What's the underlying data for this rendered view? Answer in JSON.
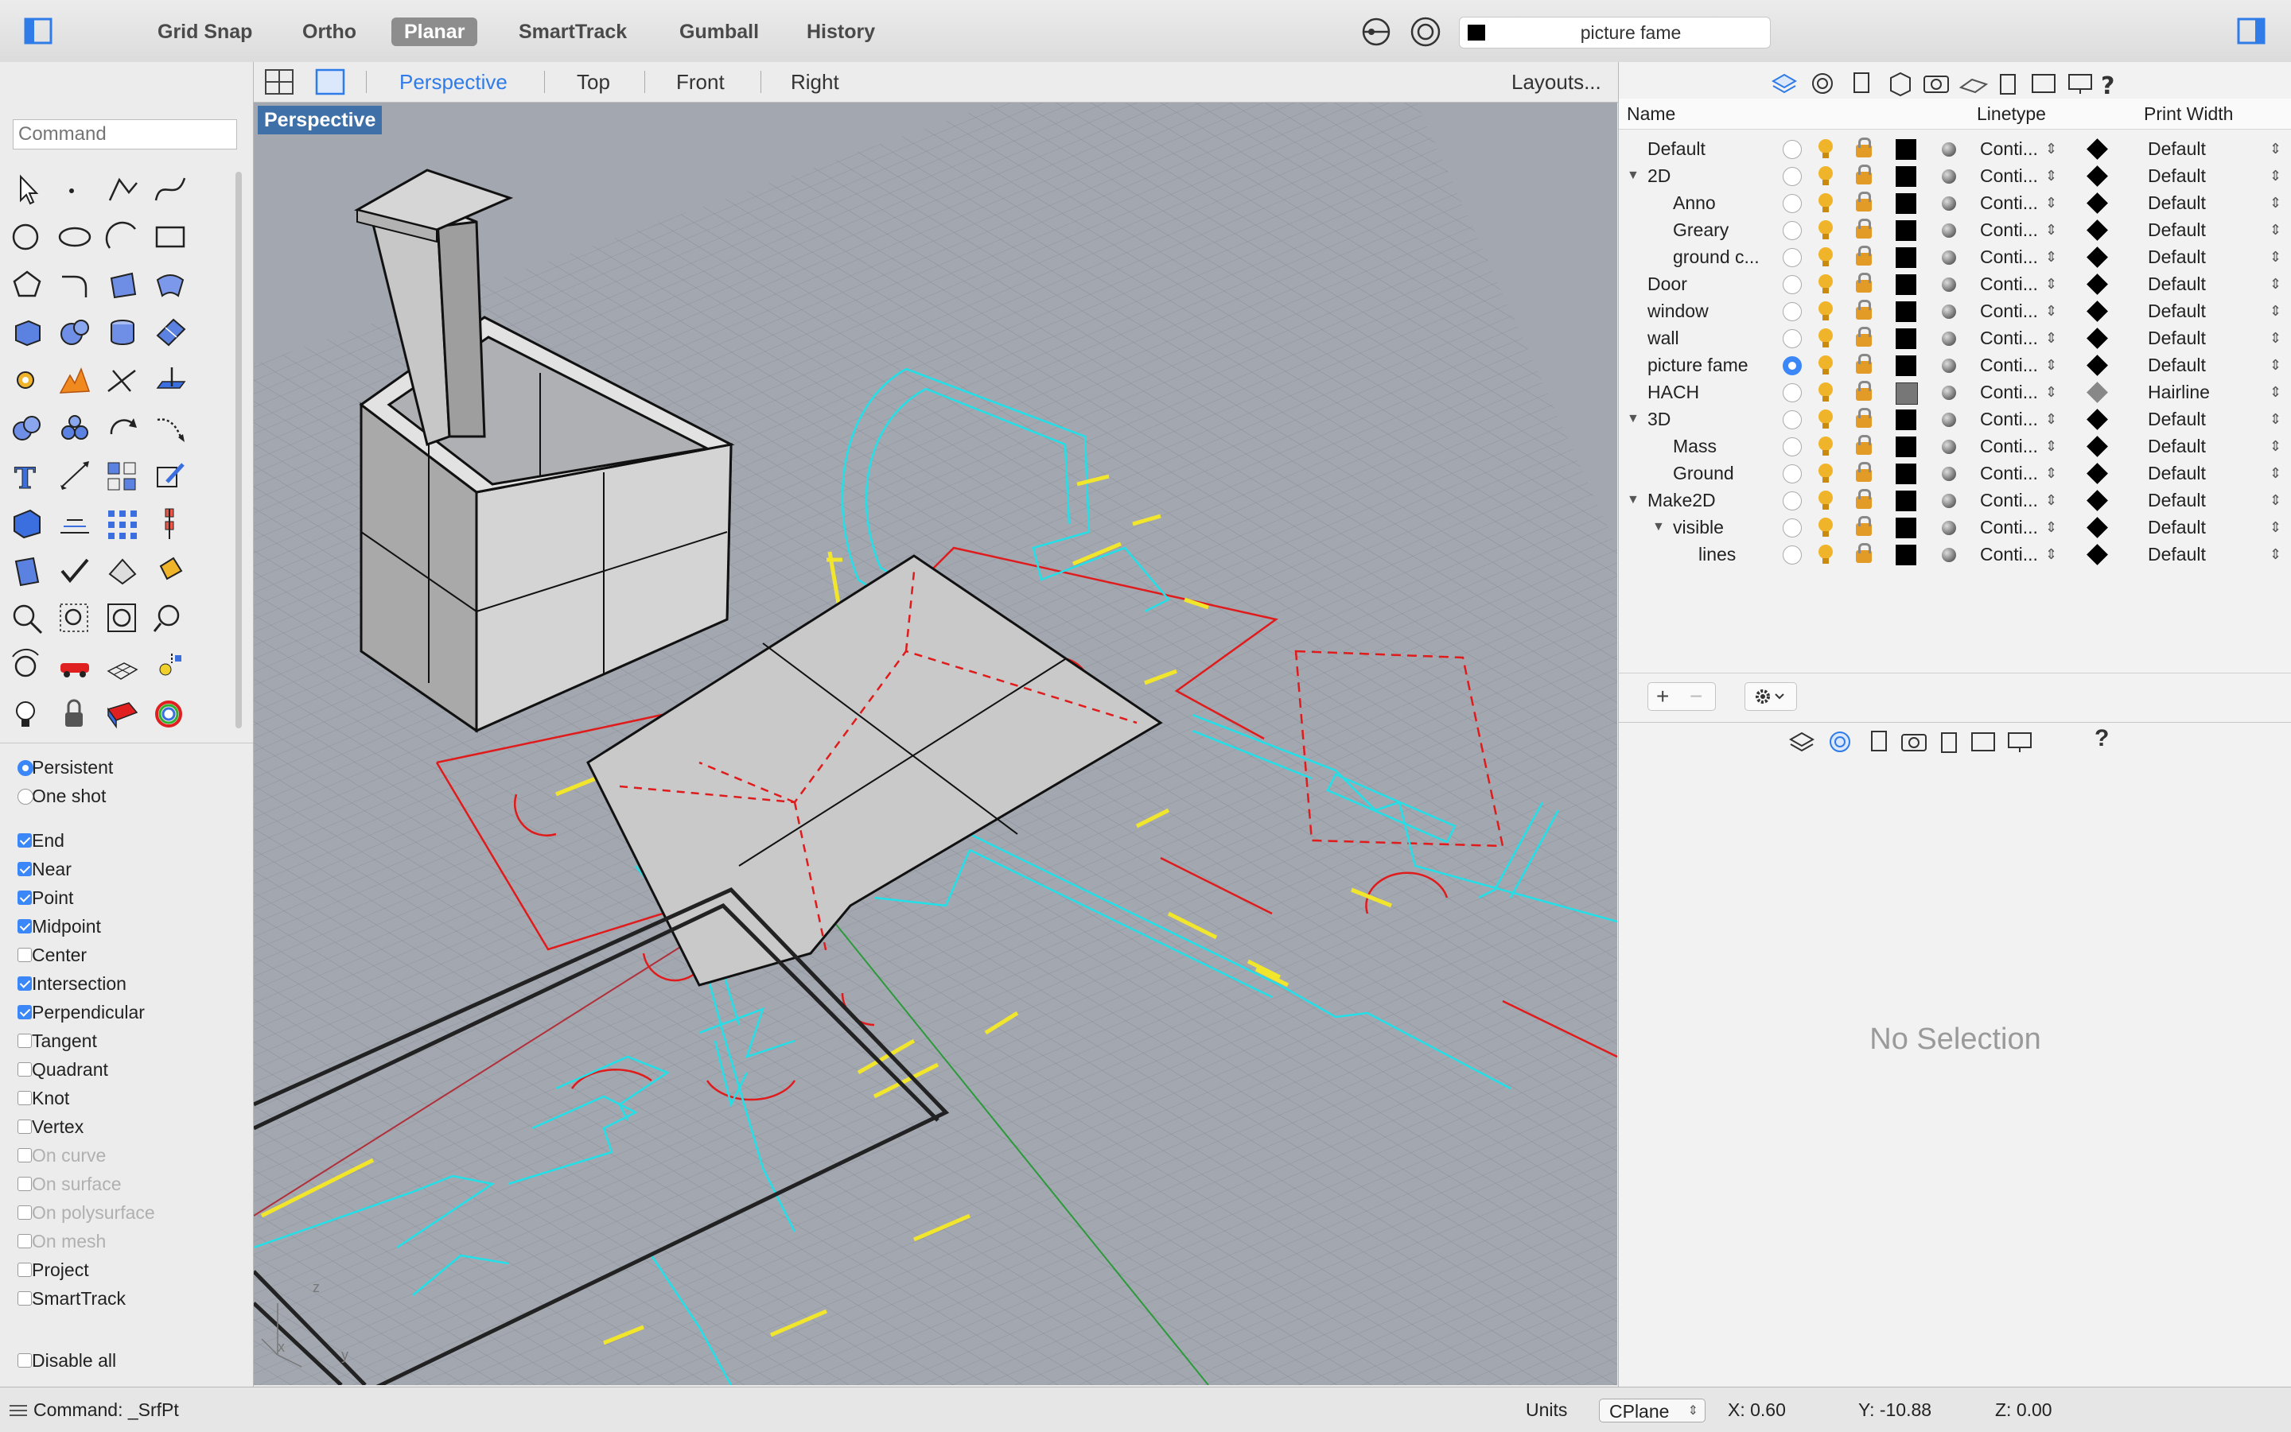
{
  "toolbar": {
    "grid_snap": "Grid Snap",
    "ortho": "Ortho",
    "planar": "Planar",
    "smarttrack": "SmartTrack",
    "gumball": "Gumball",
    "history": "History",
    "current_layer": "picture fame"
  },
  "viewbar": {
    "tabs": [
      "Perspective",
      "Top",
      "Front",
      "Right"
    ],
    "active_tab": "Perspective",
    "layouts": "Layouts..."
  },
  "command": {
    "placeholder": "Command"
  },
  "viewport": {
    "label": "Perspective",
    "axis_z": "z",
    "axis_x": "x",
    "axis_y": "y"
  },
  "snap_mode": {
    "persistent": "Persistent",
    "one_shot": "One shot",
    "selected": "Persistent"
  },
  "osnaps": [
    {
      "label": "End",
      "checked": true,
      "enabled": true
    },
    {
      "label": "Near",
      "checked": true,
      "enabled": true
    },
    {
      "label": "Point",
      "checked": true,
      "enabled": true
    },
    {
      "label": "Midpoint",
      "checked": true,
      "enabled": true
    },
    {
      "label": "Center",
      "checked": false,
      "enabled": true
    },
    {
      "label": "Intersection",
      "checked": true,
      "enabled": true
    },
    {
      "label": "Perpendicular",
      "checked": true,
      "enabled": true
    },
    {
      "label": "Tangent",
      "checked": false,
      "enabled": true
    },
    {
      "label": "Quadrant",
      "checked": false,
      "enabled": true
    },
    {
      "label": "Knot",
      "checked": false,
      "enabled": true
    },
    {
      "label": "Vertex",
      "checked": false,
      "enabled": true
    },
    {
      "label": "On curve",
      "checked": false,
      "enabled": false
    },
    {
      "label": "On surface",
      "checked": false,
      "enabled": false
    },
    {
      "label": "On polysurface",
      "checked": false,
      "enabled": false
    },
    {
      "label": "On mesh",
      "checked": false,
      "enabled": false
    },
    {
      "label": "Project",
      "checked": false,
      "enabled": true
    },
    {
      "label": "SmartTrack",
      "checked": false,
      "enabled": true
    },
    {
      "label": "Disable all",
      "checked": false,
      "enabled": true
    }
  ],
  "layers": {
    "columns": {
      "name": "Name",
      "linetype": "Linetype",
      "print_width": "Print Width"
    },
    "rows": [
      {
        "name": "Default",
        "level": 0,
        "expander": "",
        "current": false,
        "linetype": "Conti...",
        "print_width": "Default"
      },
      {
        "name": "2D",
        "level": 0,
        "expander": "▼",
        "current": false,
        "linetype": "Conti...",
        "print_width": "Default"
      },
      {
        "name": "Anno",
        "level": 1,
        "expander": "",
        "current": false,
        "linetype": "Conti...",
        "print_width": "Default"
      },
      {
        "name": "Greary",
        "level": 1,
        "expander": "",
        "current": false,
        "linetype": "Conti...",
        "print_width": "Default"
      },
      {
        "name": "ground c...",
        "level": 1,
        "expander": "",
        "current": false,
        "linetype": "Conti...",
        "print_width": "Default"
      },
      {
        "name": "Door",
        "level": 0,
        "expander": "",
        "current": false,
        "linetype": "Conti...",
        "print_width": "Default"
      },
      {
        "name": "window",
        "level": 0,
        "expander": "",
        "current": false,
        "linetype": "Conti...",
        "print_width": "Default"
      },
      {
        "name": "wall",
        "level": 0,
        "expander": "",
        "current": false,
        "linetype": "Conti...",
        "print_width": "Default"
      },
      {
        "name": "picture fame",
        "level": 0,
        "expander": "",
        "current": true,
        "linetype": "Conti...",
        "print_width": "Default"
      },
      {
        "name": "HACH",
        "level": 0,
        "expander": "",
        "current": false,
        "linetype": "Conti...",
        "print_width": "Hairline"
      },
      {
        "name": "3D",
        "level": 0,
        "expander": "▼",
        "current": false,
        "linetype": "Conti...",
        "print_width": "Default"
      },
      {
        "name": "Mass",
        "level": 1,
        "expander": "",
        "current": false,
        "linetype": "Conti...",
        "print_width": "Default"
      },
      {
        "name": "Ground",
        "level": 1,
        "expander": "",
        "current": false,
        "linetype": "Conti...",
        "print_width": "Default"
      },
      {
        "name": "Make2D",
        "level": 0,
        "expander": "▼",
        "current": false,
        "linetype": "Conti...",
        "print_width": "Default"
      },
      {
        "name": "visible",
        "level": 1,
        "expander": "▼",
        "current": false,
        "linetype": "Conti...",
        "print_width": "Default"
      },
      {
        "name": "lines",
        "level": 2,
        "expander": "",
        "current": false,
        "linetype": "Conti...",
        "print_width": "Default"
      }
    ],
    "add_symbol": "+",
    "remove_symbol": "−",
    "help_symbol": "?"
  },
  "properties": {
    "empty_text": "No Selection",
    "help_symbol": "?"
  },
  "status": {
    "command": "Command: _SrfPt",
    "units_label": "Units",
    "cplane": "CPlane",
    "x": "X: 0.60",
    "y": "Y: -10.88",
    "z": "Z: 0.00"
  },
  "colors": {
    "accent": "#3b87f7",
    "viewport_bg": "#9fa3ad",
    "grid": "#8e929c",
    "cyan_lines": "#22e0e8",
    "red_lines": "#e01b1b",
    "yellow_lines": "#f2e62c",
    "label_bg": "#3f71a8"
  }
}
